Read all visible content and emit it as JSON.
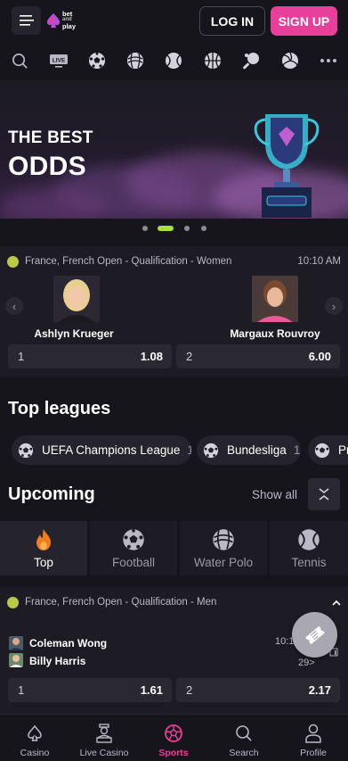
{
  "header": {
    "logo_line1": "bet",
    "logo_line2": "and",
    "logo_line3": "play",
    "login_label": "LOG IN",
    "signup_label": "SIGN UP"
  },
  "sport_icons": [
    "search-icon",
    "live-icon",
    "football-icon",
    "water-polo-icon",
    "basketball-icon",
    "basketball-icon",
    "table-tennis-icon",
    "volleyball-icon",
    "more-icon"
  ],
  "banner": {
    "line1": "THE BEST",
    "line2": "ODDS",
    "slide_count": 4,
    "active_slide": 1
  },
  "featured_match": {
    "league": "France, French Open - Qualification - Women",
    "time": "10:10 AM",
    "player1": "Ashlyn Krueger",
    "player2": "Margaux Rouvroy",
    "odds": [
      {
        "label": "1",
        "value": "1.08"
      },
      {
        "label": "2",
        "value": "6.00"
      }
    ]
  },
  "top_leagues": {
    "title": "Top leagues",
    "items": [
      {
        "name": "UEFA Champions League",
        "count": "1"
      },
      {
        "name": "Bundesliga",
        "count": "1"
      },
      {
        "name": "Pr",
        "count": ""
      }
    ]
  },
  "upcoming": {
    "title": "Upcoming",
    "show_all": "Show all",
    "tabs": [
      {
        "label": "Top",
        "icon": "fire-icon"
      },
      {
        "label": "Football",
        "icon": "football-icon"
      },
      {
        "label": "Water Polo",
        "icon": "water-polo-icon"
      },
      {
        "label": "Tennis",
        "icon": "tennis-icon"
      }
    ],
    "active_tab": 0
  },
  "upcoming_match": {
    "league": "France, French Open - Qualification - Men",
    "time": "10:1",
    "more_markets": "29>",
    "player1": "Coleman Wong",
    "player2": "Billy Harris",
    "odds": [
      {
        "label": "1",
        "value": "1.61"
      },
      {
        "label": "2",
        "value": "2.17"
      }
    ]
  },
  "bottom_nav": [
    {
      "label": "Casino",
      "icon": "spade-icon"
    },
    {
      "label": "Live Casino",
      "icon": "dealer-icon"
    },
    {
      "label": "Sports",
      "icon": "sports-icon"
    },
    {
      "label": "Search",
      "icon": "search-icon"
    },
    {
      "label": "Profile",
      "icon": "profile-icon"
    }
  ],
  "colors": {
    "background": "#16151b",
    "card": "#1d1c24",
    "accent_pink": "#e8409a",
    "accent_green": "#a6e23a",
    "fire_orange": "#f47b20"
  }
}
